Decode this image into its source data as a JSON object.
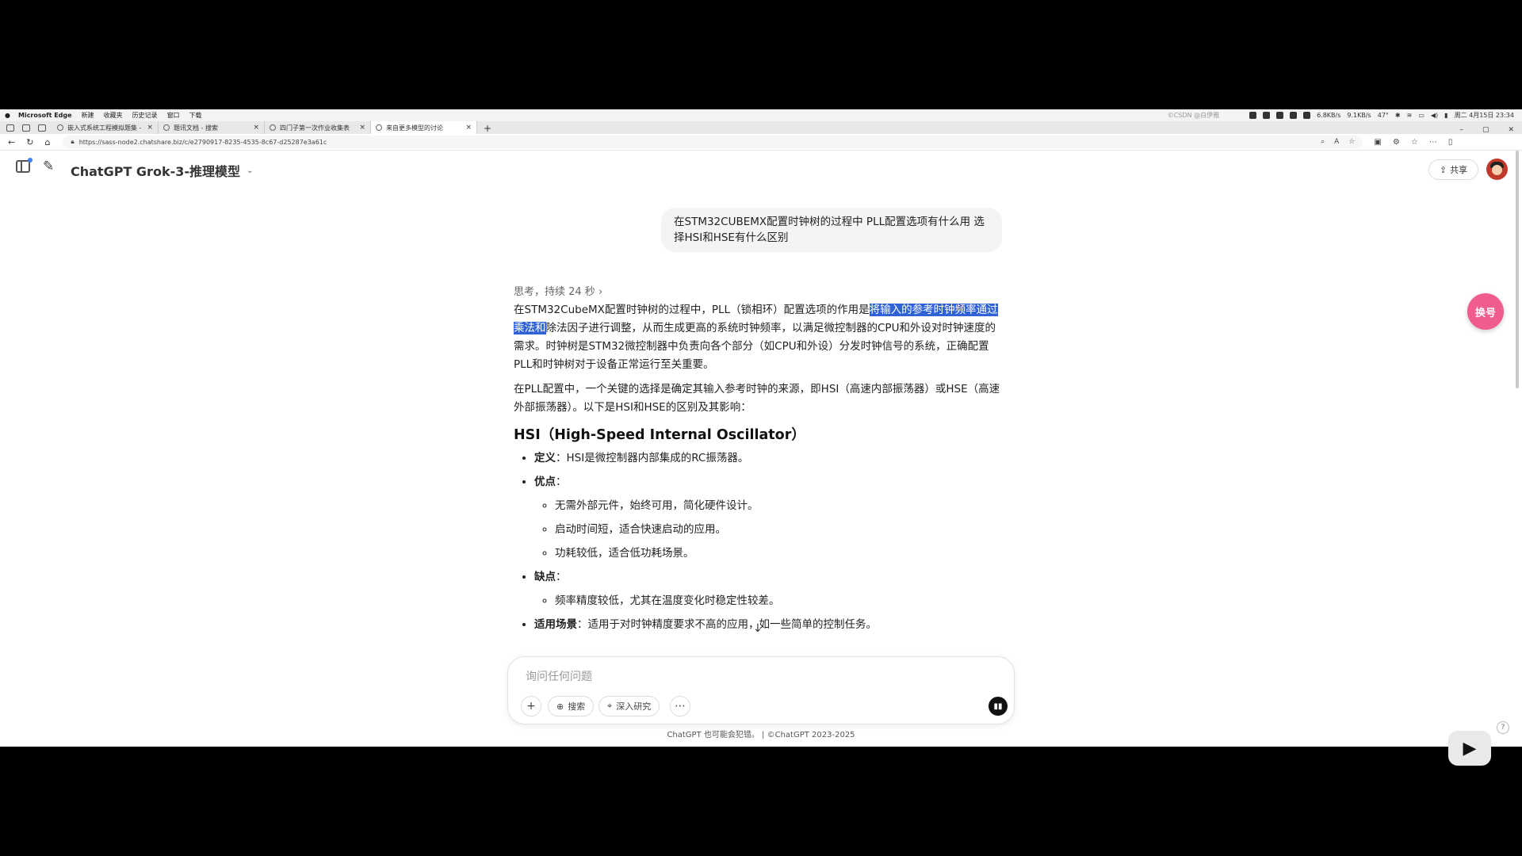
{
  "menubar": {
    "app": "Microsoft Edge",
    "items": [
      "新建",
      "收藏夹",
      "历史记录",
      "窗口",
      "下载"
    ],
    "tray_watermark": "©CSDN @白伊雅",
    "net_up": "6.8KB/s",
    "net_down": "9.1KB/s",
    "temp": "47°",
    "datetime": "周二 4月15日 23:34"
  },
  "tabs": [
    {
      "title": "嵌入式系统工程模拟题集 - 来源知识"
    },
    {
      "title": "题讯文档 - 搜索"
    },
    {
      "title": "四门子第一次作业收集表"
    },
    {
      "title": "来自更多模型的讨论"
    }
  ],
  "address": {
    "url": "https://sass-node2.chatshare.biz/c/e2790917-8235-4535-8c67-d25287e3a61c"
  },
  "header": {
    "model_title": "ChatGPT Grok-3-推理模型",
    "share_label": "共享"
  },
  "user_message": "在STM32CUBEMX配置时钟树的过程中 PLL配置选项有什么用 选择HSI和HSE有什么区别",
  "answer": {
    "thinking": "思考，持续 24 秒",
    "p1_pre": "在STM32CubeMX配置时钟树的过程中，PLL（锁相环）配置选项的作用是",
    "p1_hl": "将输入的参考时钟频率通过乘法和",
    "p1_post": "除法因子进行调整，从而生成更高的系统时钟频率，以满足微控制器的CPU和外设对时钟速度的需求。时钟树是STM32微控制器中负责向各个部分（如CPU和外设）分发时钟信号的系统，正确配置PLL和时钟树对于设备正常运行至关重要。",
    "p2": "在PLL配置中，一个关键的选择是确定其输入参考时钟的来源，即HSI（高速内部振荡器）或HSE（高速外部振荡器）。以下是HSI和HSE的区别及其影响：",
    "h3": "HSI（High-Speed Internal Oscillator）",
    "def_label": "定义",
    "def_text": "：HSI是微控制器内部集成的RC振荡器。",
    "pros_label": "优点",
    "colon": "：",
    "pros": [
      "无需外部元件，始终可用，简化硬件设计。",
      "启动时间短，适合快速启动的应用。",
      "功耗较低，适合低功耗场景。"
    ],
    "cons_label": "缺点",
    "cons": [
      "频率精度较低，尤其在温度变化时稳定性较差。"
    ],
    "use_label": "适用场景",
    "use_text": "：适用于对时钟精度要求不高的应用，如一些简单的控制任务。"
  },
  "composer": {
    "placeholder": "询问任何问题",
    "search_label": "搜索",
    "research_label": "深入研究"
  },
  "footer": "ChatGPT 也可能会犯错。 | ©ChatGPT 2023-2025",
  "float_button": "换号"
}
